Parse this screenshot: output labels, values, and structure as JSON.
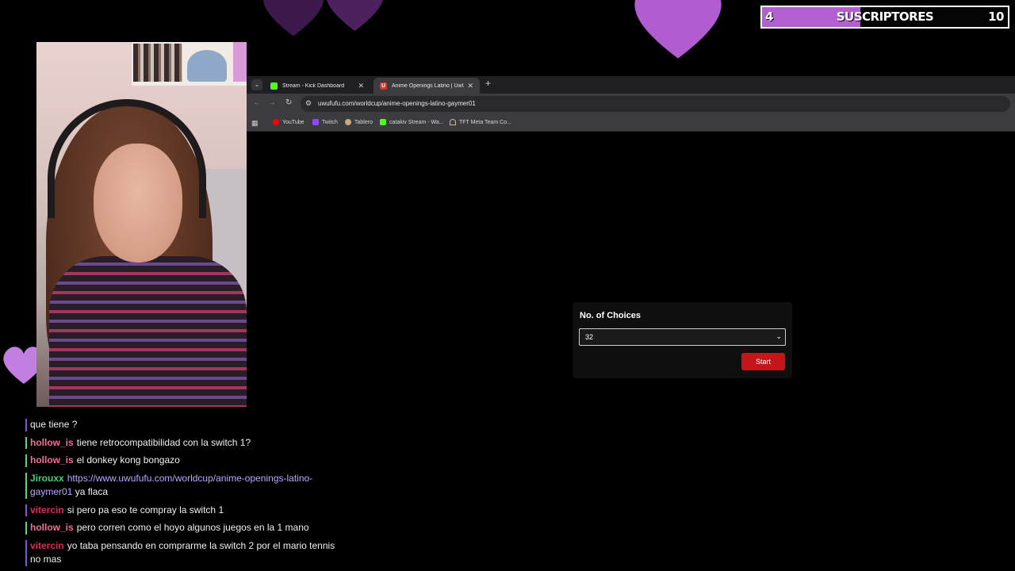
{
  "colors": {
    "heart": "#b15dd1",
    "goal_fill": "#b25fd0",
    "start_button": "#c5151b",
    "link": "#b9a6ff"
  },
  "subscriber_goal": {
    "current": "4",
    "label": "SUSCRIPTORES",
    "target": "10",
    "progress_fraction": 0.4
  },
  "browser": {
    "tabs": [
      {
        "favicon": "kick-icon",
        "title": "Stream - Kick Dashboard",
        "close": "✕"
      },
      {
        "favicon": "uwufufu-icon",
        "title": "Anime Openings Latino | UwUf",
        "close": "✕",
        "active": true
      }
    ],
    "new_tab": "+",
    "url": "uwufufu.com/worldcup/anime-openings-latino-gaymer01",
    "bookmarks": [
      {
        "icon": "youtube-icon",
        "label": "YouTube"
      },
      {
        "icon": "twitch-icon",
        "label": "Twitch"
      },
      {
        "icon": "tablero-icon",
        "label": "Tablero"
      },
      {
        "icon": "kick-icon",
        "label": "catakiv Stream - Wa..."
      },
      {
        "icon": "tft-icon",
        "label": "TFT Meta Team Co..."
      }
    ]
  },
  "page": {
    "choices_label": "No. of Choices",
    "choices_value": "32",
    "start_label": "Start"
  },
  "chat": [
    {
      "user": "",
      "user_color": "",
      "bar_color": "#7b59d6",
      "text": "que tiene ?"
    },
    {
      "user": "hollow_is",
      "user_color": "#f06e9c",
      "bar_color": "#5fd37b",
      "text": "tiene retrocompatibilidad con la switch 1?"
    },
    {
      "user": "hollow_is",
      "user_color": "#f06e9c",
      "bar_color": "#5fd37b",
      "text": "el donkey kong bongazo"
    },
    {
      "user": "Jirouxx",
      "user_color": "#3ed17a",
      "bar_color": "#5fd37b",
      "link": "https://www.uwufufu.com/worldcup/anime-openings-latino-gaymer01",
      "text": "ya flaca"
    },
    {
      "user": "vitercin",
      "user_color": "#e0265a",
      "bar_color": "#7b59d6",
      "text": "si pero pa eso te compray la switch 1"
    },
    {
      "user": "hollow_is",
      "user_color": "#f06e9c",
      "bar_color": "#5fd37b",
      "text": "pero corren como el hoyo algunos juegos en la 1 mano"
    },
    {
      "user": "vitercin",
      "user_color": "#e0265a",
      "bar_color": "#7b59d6",
      "text": "yo taba pensando en comprarme la switch 2 por el mario tennis no mas"
    }
  ]
}
